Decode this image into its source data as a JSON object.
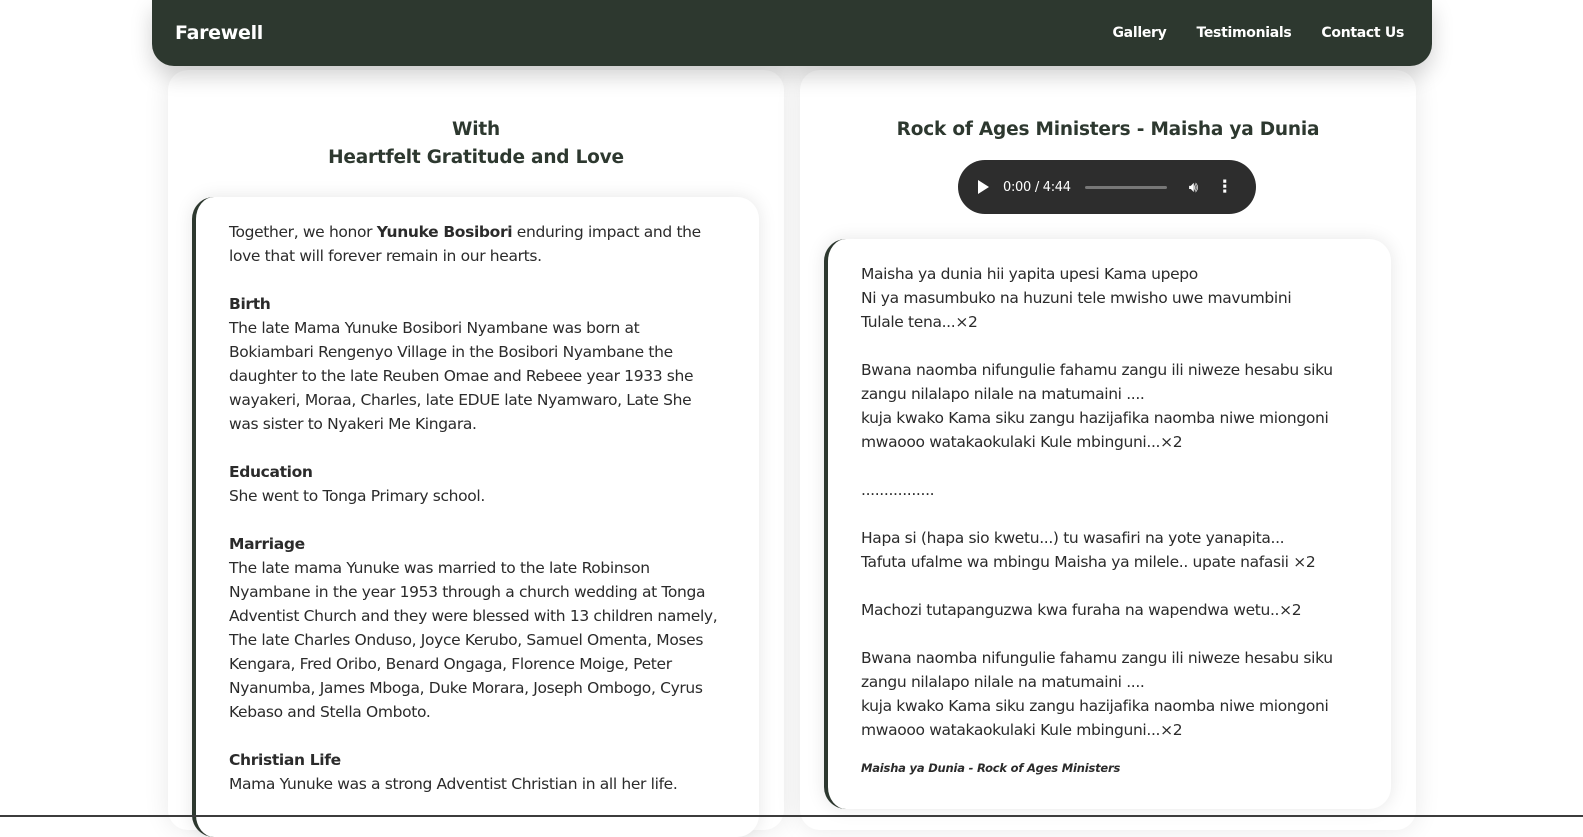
{
  "nav": {
    "brand": "Farewell",
    "links": [
      "Gallery",
      "Testimonials",
      "Contact Us"
    ]
  },
  "left": {
    "title_line1": "With",
    "title_line2": "Heartfelt Gratitude and Love",
    "intro_before": "Together, we honor ",
    "intro_name": "Yunuke Bosibori",
    "intro_after": " enduring impact and the love that will forever remain in our hearts.",
    "sections": [
      {
        "heading": "Birth",
        "text": "The late Mama Yunuke Bosibori Nyambane was born at Bokiambari Rengenyo Village in the Bosibori Nyambane the daughter to the late Reuben Omae and Rebeee year 1933 she wayakeri, Moraa, Charles, late EDUE late Nyamwaro, Late She was sister to Nyakeri Me Kingara."
      },
      {
        "heading": "Education",
        "text": "She went to Tonga Primary school."
      },
      {
        "heading": "Marriage",
        "text": "The late mama Yunuke was married to the late Robinson Nyambane in the year 1953 through a church wedding at Tonga Adventist Church and they were blessed with 13 children namely, The late Charles Onduso, Joyce Kerubo, Samuel Omenta, Moses Kengara, Fred Oribo, Benard Ongaga, Florence Moige, Peter Nyanumba, James Mboga, Duke Morara, Joseph Ombogo, Cyrus Kebaso and Stella Omboto."
      },
      {
        "heading": "Christian Life",
        "text": "Mama Yunuke was a strong Adventist Christian in all her life."
      }
    ]
  },
  "right": {
    "title": "Rock of Ages Ministers - Maisha ya Dunia",
    "audio": {
      "time": "0:00 / 4:44"
    },
    "lyrics": [
      "Maisha ya dunia hii yapita upesi Kama upepo\nNi ya masumbuko na huzuni tele mwisho uwe mavumbini\nTulale tena...×2",
      "Bwana naomba nifungulie fahamu zangu ili niweze hesabu siku zangu nilalapo nilale na matumaini ....\nkuja kwako Kama siku zangu hazijafika naomba niwe miongoni mwaooo watakaokulaki Kule mbinguni...×2",
      "................",
      "Hapa si (hapa sio kwetu...) tu wasafiri na yote yanapita...\nTafuta ufalme wa mbingu Maisha ya milele.. upate nafasii ×2",
      "Machozi tutapanguzwa kwa furaha na wapendwa wetu..×2",
      "Bwana naomba nifungulie fahamu zangu ili niweze hesabu siku zangu nilalapo nilale na matumaini ....\nkuja kwako Kama siku zangu hazijafika naomba niwe miongoni mwaooo watakaokulaki Kule mbinguni...×2"
    ],
    "caption": "Maisha ya Dunia - Rock of Ages Ministers"
  }
}
